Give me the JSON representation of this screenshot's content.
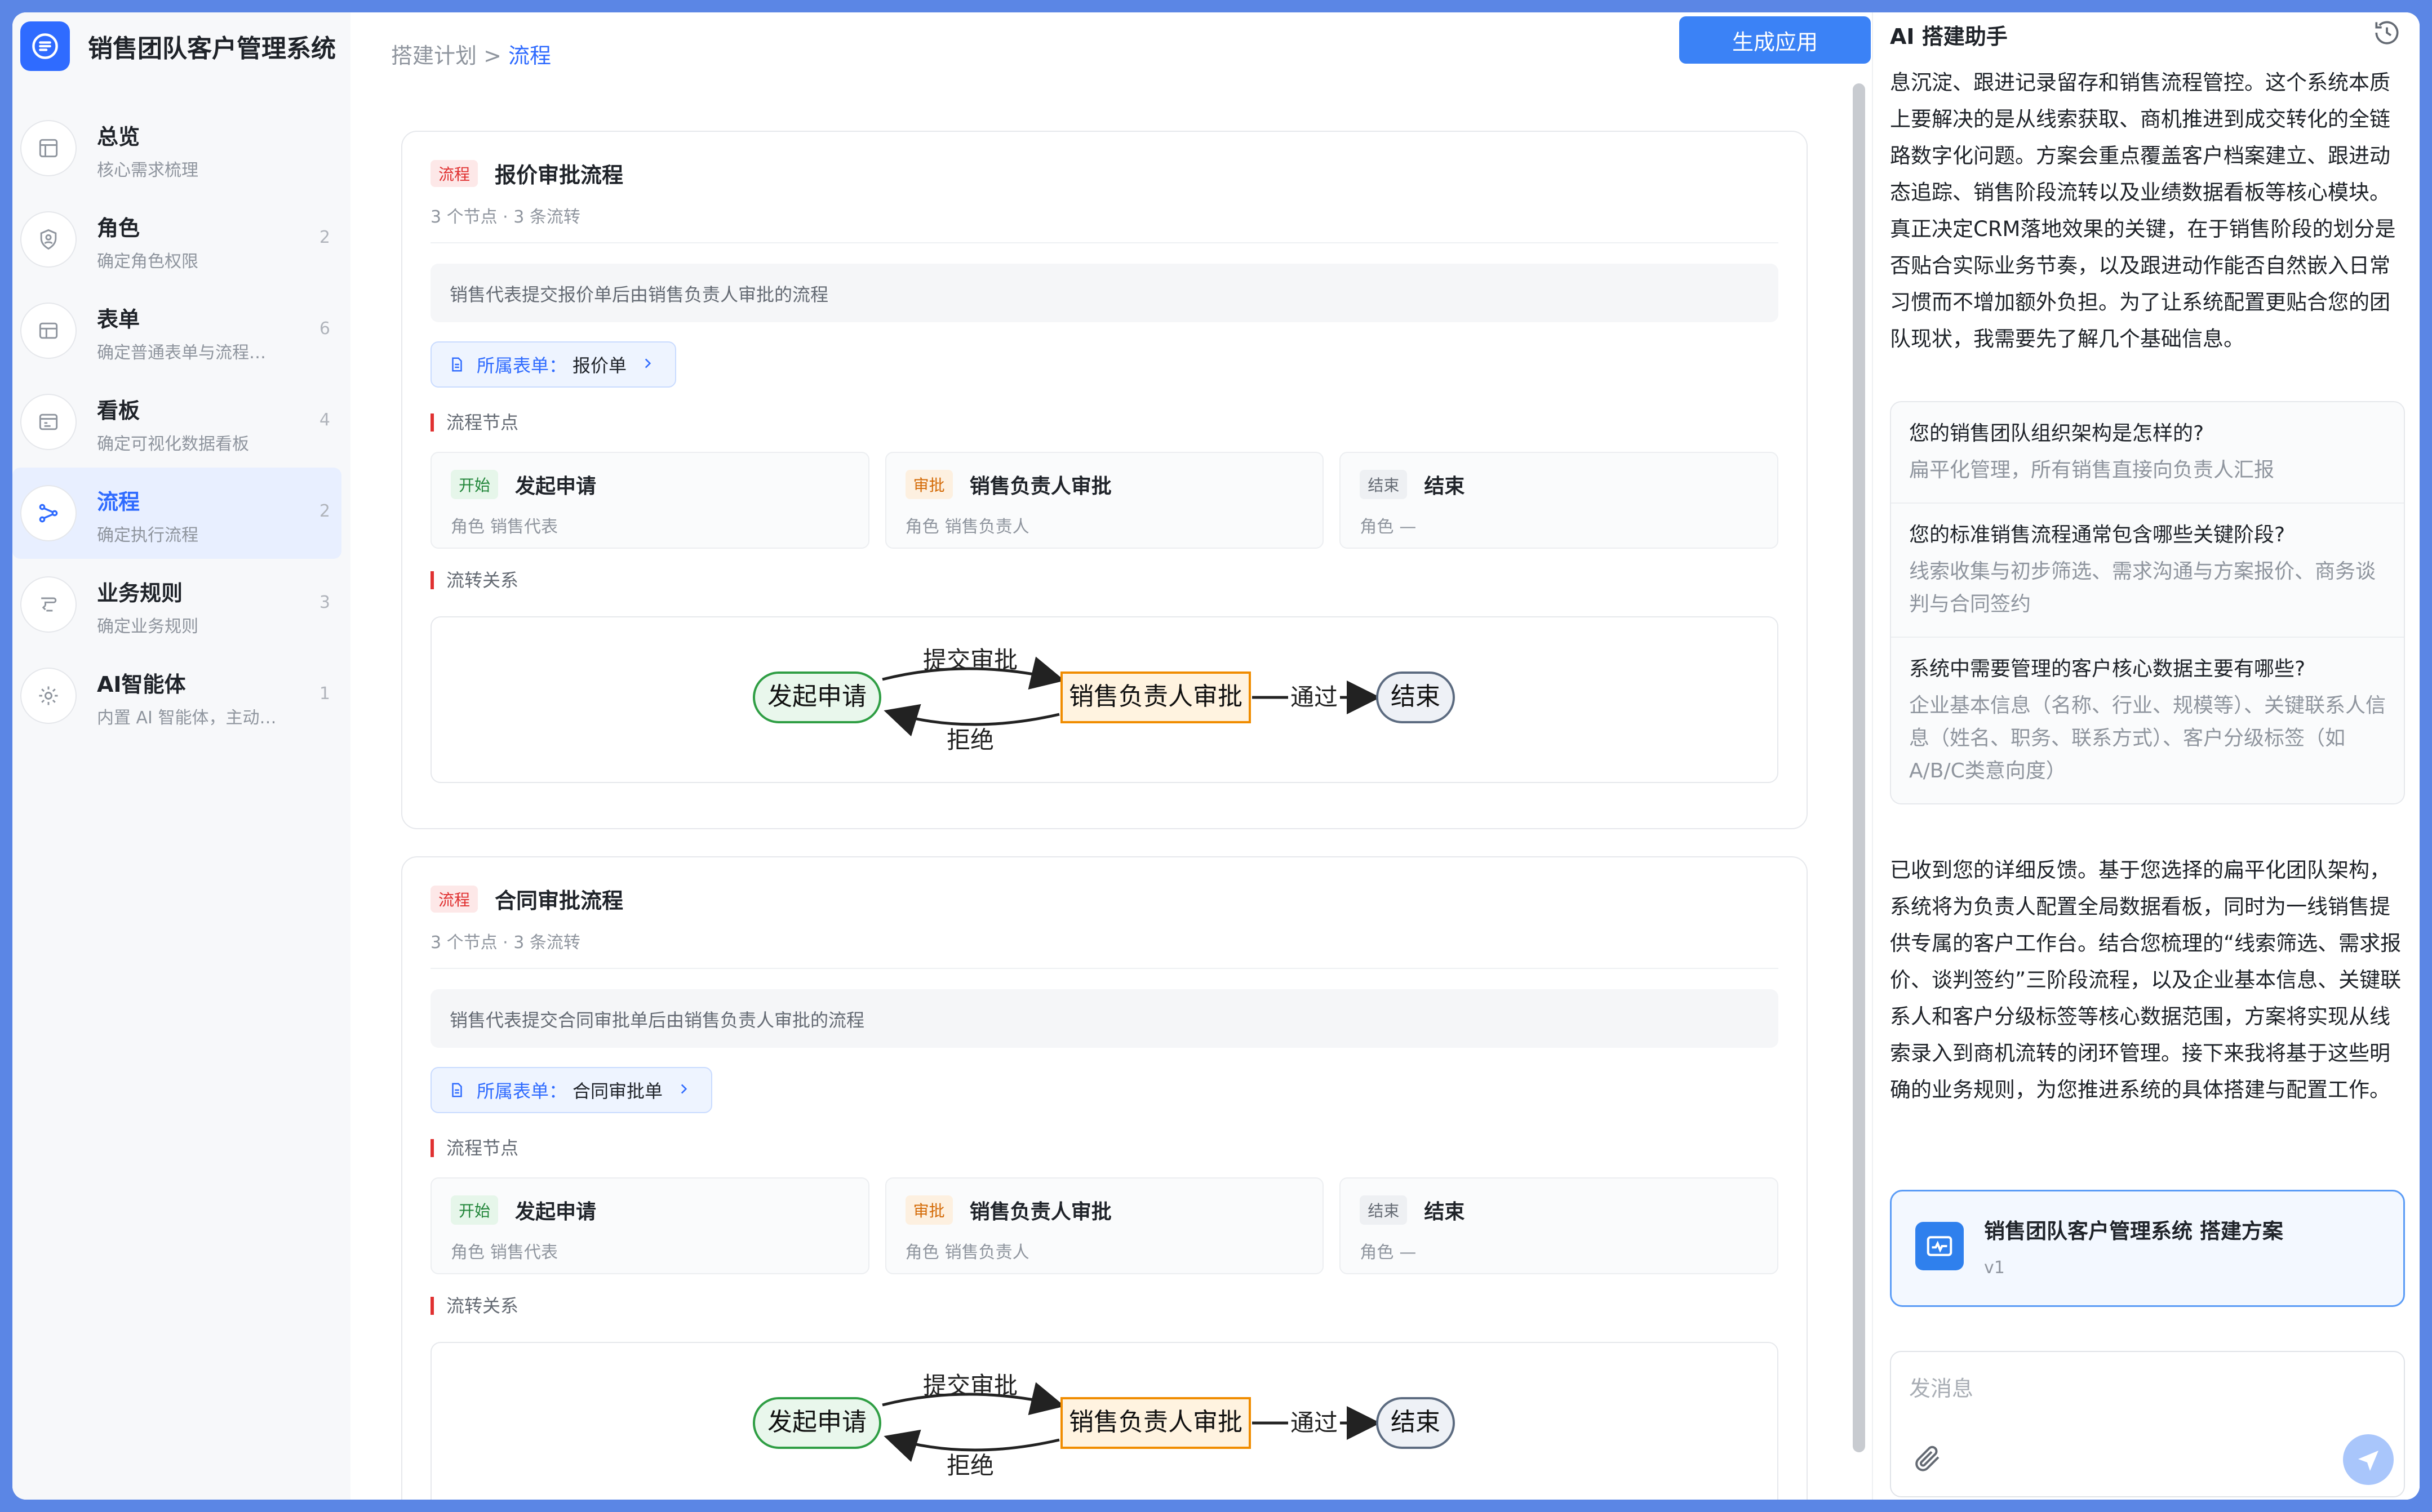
{
  "app": {
    "title": "销售团队客户管理系统"
  },
  "breadcrumb": {
    "parent": "搭建计划 >",
    "current": "流程"
  },
  "header": {
    "generate_label": "生成应用"
  },
  "sidebar": {
    "items": [
      {
        "label": "总览",
        "sub": "核心需求梳理",
        "count": ""
      },
      {
        "label": "角色",
        "sub": "确定角色权限",
        "count": "2"
      },
      {
        "label": "表单",
        "sub": "确定普通表单与流程…",
        "count": "6"
      },
      {
        "label": "看板",
        "sub": "确定可视化数据看板",
        "count": "4"
      },
      {
        "label": "流程",
        "sub": "确定执行流程",
        "count": "2"
      },
      {
        "label": "业务规则",
        "sub": "确定业务规则",
        "count": "3"
      },
      {
        "label": "AI智能体",
        "sub": "内置 AI 智能体，主动…",
        "count": "1"
      }
    ],
    "active_index": 4
  },
  "labels": {
    "form_prefix": "所属表单：",
    "nodes_section": "流程节点",
    "relations_section": "流转关系",
    "role_prefix": "角色"
  },
  "flows": [
    {
      "tag": "流程",
      "title": "报价审批流程",
      "meta": "3 个节点 · 3 条流转",
      "description": "销售代表提交报价单后由销售负责人审批的流程",
      "form": "报价单",
      "nodes": [
        {
          "tag": "开始",
          "name": "发起申请",
          "role": "销售代表"
        },
        {
          "tag": "审批",
          "name": "销售负责人审批",
          "role": "销售负责人"
        },
        {
          "tag": "结束",
          "name": "结束",
          "role": "—"
        }
      ],
      "diagram": {
        "start": "发起申请",
        "approve": "销售负责人审批",
        "end": "结束",
        "submit": "提交审批",
        "reject": "拒绝",
        "pass": "通过"
      }
    },
    {
      "tag": "流程",
      "title": "合同审批流程",
      "meta": "3 个节点 · 3 条流转",
      "description": "销售代表提交合同审批单后由销售负责人审批的流程",
      "form": "合同审批单",
      "nodes": [
        {
          "tag": "开始",
          "name": "发起申请",
          "role": "销售代表"
        },
        {
          "tag": "审批",
          "name": "销售负责人审批",
          "role": "销售负责人"
        },
        {
          "tag": "结束",
          "name": "结束",
          "role": "—"
        }
      ],
      "diagram": {
        "start": "发起申请",
        "approve": "销售负责人审批",
        "end": "结束",
        "submit": "提交审批",
        "reject": "拒绝",
        "pass": "通过"
      }
    }
  ],
  "assistant": {
    "title": "AI 搭建助手",
    "intro": "息沉淀、跟进记录留存和销售流程管控。这个系统本质上要解决的是从线索获取、商机推进到成交转化的全链路数字化问题。方案会重点覆盖客户档案建立、跟进动态追踪、销售阶段流转以及业绩数据看板等核心模块。真正决定CRM落地效果的关键，在于销售阶段的划分是否贴合实际业务节奏，以及跟进动作能否自然嵌入日常习惯而不增加额外负担。为了让系统配置更贴合您的团队现状，我需要先了解几个基础信息。",
    "qa": [
      {
        "q": "您的销售团队组织架构是怎样的?",
        "a": "扁平化管理，所有销售直接向负责人汇报"
      },
      {
        "q": "您的标准销售流程通常包含哪些关键阶段?",
        "a": "线索收集与初步筛选、需求沟通与方案报价、商务谈判与合同签约"
      },
      {
        "q": "系统中需要管理的客户核心数据主要有哪些?",
        "a": "企业基本信息（名称、行业、规模等）、关键联系人信息（姓名、职务、联系方式）、客户分级标签（如A/B/C类意向度）"
      }
    ],
    "reply": "已收到您的详细反馈。基于您选择的扁平化团队架构，系统将为负责人配置全局数据看板，同时为一线销售提供专属的客户工作台。结合您梳理的“线索筛选、需求报价、谈判签约”三阶段流程，以及企业基本信息、关键联系人和客户分级标签等核心数据范围，方案将实现从线索录入到商机流转的闭环管理。接下来我将基于这些明确的业务规则，为您推进系统的具体搭建与配置工作。",
    "plan": {
      "title": "销售团队客户管理系统  搭建方案",
      "version": "v1"
    },
    "composer_placeholder": "发消息"
  }
}
